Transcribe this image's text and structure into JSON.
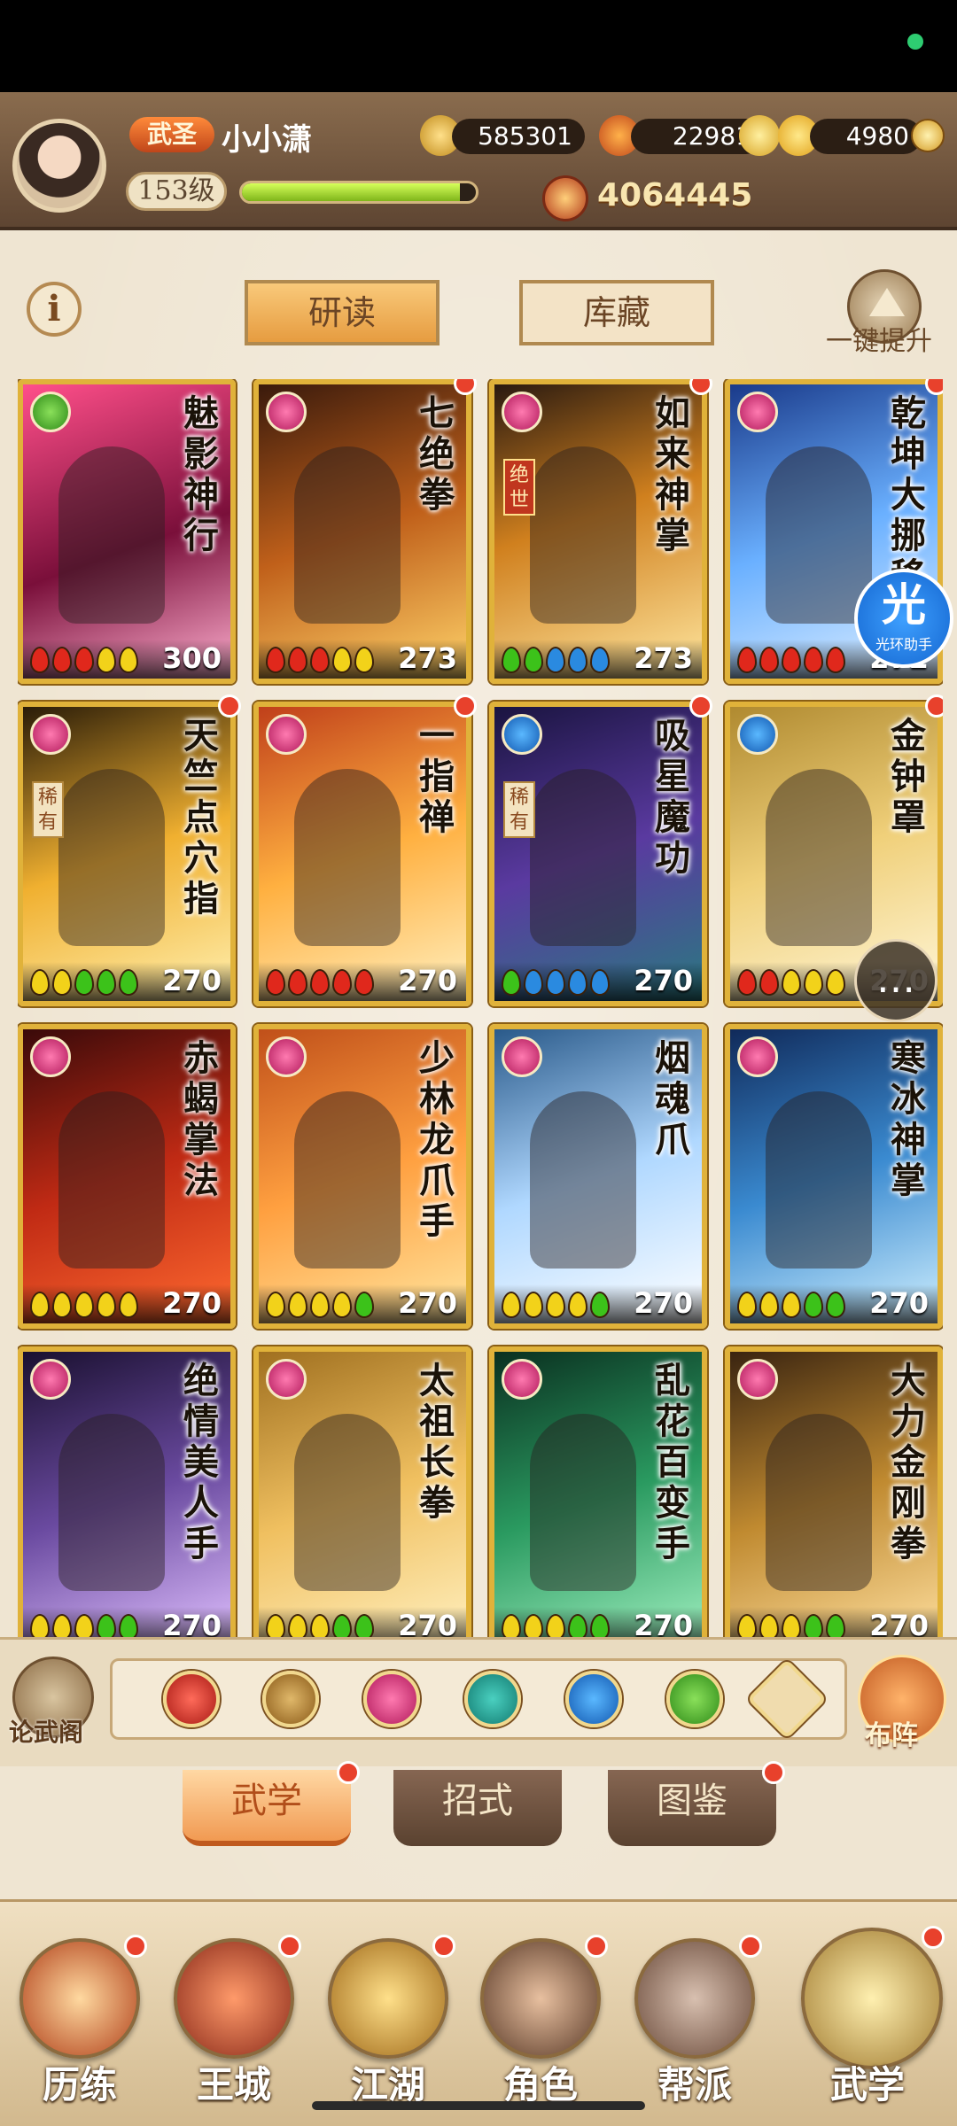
{
  "colors": {
    "accent": "#e69c40",
    "card_border": "#e0b23a",
    "notification": "#e8412c",
    "exp_bar": "#a8d43a"
  },
  "header": {
    "rank": "武圣",
    "player_name": "小小潇",
    "level": "153级",
    "exp_fraction": 0.93,
    "currencies": [
      {
        "name": "copper-coin",
        "value": "585301"
      },
      {
        "name": "flame-crystal",
        "value": "22981"
      },
      {
        "name": "gold-ingot",
        "value": "4980"
      }
    ],
    "combat_power": "4064445"
  },
  "toolbar": {
    "info_label": "i",
    "tabs": [
      {
        "label": "研读",
        "active": true
      },
      {
        "label": "库藏",
        "active": false
      }
    ],
    "upgrade_label": "一键提升"
  },
  "cards": [
    {
      "title": "魅影神行",
      "score": "300",
      "type_icon": "green-swirl",
      "gems": [
        "red",
        "red",
        "red",
        "yellow",
        "yellow"
      ],
      "tag": "",
      "notify": false
    },
    {
      "title": "七绝拳",
      "score": "273",
      "type_icon": "pink-lotus",
      "gems": [
        "red",
        "red",
        "red",
        "yellow",
        "yellow"
      ],
      "tag": "",
      "notify": true
    },
    {
      "title": "如来神掌",
      "score": "273",
      "type_icon": "pink-lotus",
      "gems": [
        "green",
        "green",
        "blue",
        "blue",
        "blue"
      ],
      "tag": "绝世",
      "notify": true
    },
    {
      "title": "乾坤大挪移",
      "score": "272",
      "type_icon": "pink-lotus",
      "gems": [
        "red",
        "red",
        "red",
        "red",
        "red"
      ],
      "tag": "",
      "notify": true
    },
    {
      "title": "天竺点穴指",
      "score": "270",
      "type_icon": "pink-lotus",
      "gems": [
        "yellow",
        "yellow",
        "green",
        "green",
        "green"
      ],
      "tag": "稀有",
      "notify": true
    },
    {
      "title": "一指禅",
      "score": "270",
      "type_icon": "pink-lotus",
      "gems": [
        "red",
        "red",
        "red",
        "red",
        "red"
      ],
      "tag": "",
      "notify": true
    },
    {
      "title": "吸星魔功",
      "score": "270",
      "type_icon": "blue-taiji",
      "gems": [
        "green",
        "blue",
        "blue",
        "blue",
        "blue"
      ],
      "tag": "稀有",
      "notify": true
    },
    {
      "title": "金钟罩",
      "score": "270",
      "type_icon": "blue-taiji",
      "gems": [
        "red",
        "red",
        "yellow",
        "yellow",
        "yellow"
      ],
      "tag": "",
      "notify": true
    },
    {
      "title": "赤蝎掌法",
      "score": "270",
      "type_icon": "pink-lotus",
      "gems": [
        "yellow",
        "yellow",
        "yellow",
        "yellow",
        "yellow"
      ],
      "tag": "",
      "notify": false
    },
    {
      "title": "少林龙爪手",
      "score": "270",
      "type_icon": "pink-lotus",
      "gems": [
        "yellow",
        "yellow",
        "yellow",
        "yellow",
        "green"
      ],
      "tag": "",
      "notify": false
    },
    {
      "title": "烟魂爪",
      "score": "270",
      "type_icon": "pink-lotus",
      "gems": [
        "yellow",
        "yellow",
        "yellow",
        "yellow",
        "green"
      ],
      "tag": "",
      "notify": false
    },
    {
      "title": "寒冰神掌",
      "score": "270",
      "type_icon": "pink-lotus",
      "gems": [
        "yellow",
        "yellow",
        "yellow",
        "green",
        "green"
      ],
      "tag": "",
      "notify": false
    },
    {
      "title": "绝情美人手",
      "score": "270",
      "type_icon": "pink-lotus",
      "gems": [
        "yellow",
        "yellow",
        "yellow",
        "green",
        "green"
      ],
      "tag": "",
      "notify": false
    },
    {
      "title": "太祖长拳",
      "score": "270",
      "type_icon": "pink-lotus",
      "gems": [
        "yellow",
        "yellow",
        "yellow",
        "green",
        "green"
      ],
      "tag": "",
      "notify": false
    },
    {
      "title": "乱花百变手",
      "score": "270",
      "type_icon": "pink-lotus",
      "gems": [
        "yellow",
        "yellow",
        "yellow",
        "green",
        "green"
      ],
      "tag": "",
      "notify": false
    },
    {
      "title": "大力金刚拳",
      "score": "270",
      "type_icon": "pink-lotus",
      "gems": [
        "yellow",
        "yellow",
        "yellow",
        "green",
        "green"
      ],
      "tag": "",
      "notify": false
    }
  ],
  "assistant": {
    "glyph": "光",
    "label": "光环助手"
  },
  "chat": {
    "glyph": "…"
  },
  "filter_bar": {
    "left_label": "论武阁",
    "icons": [
      "red-sword-icon",
      "gold-spear-icon",
      "pink-lotus-icon",
      "teal-fan-icon",
      "blue-taiji-icon",
      "green-swirl-icon",
      "sort-arrow-icon"
    ],
    "right_label": "布阵"
  },
  "sub_tabs": [
    {
      "label": "武学",
      "active": true,
      "notify": true
    },
    {
      "label": "招式",
      "active": false,
      "notify": false
    },
    {
      "label": "图鉴",
      "active": false,
      "notify": true
    }
  ],
  "bottom_nav": [
    {
      "label": "历练",
      "icon": "scroll-sword-icon",
      "notify": true
    },
    {
      "label": "王城",
      "icon": "palace-gate-icon",
      "notify": true
    },
    {
      "label": "江湖",
      "icon": "sword-cloud-icon",
      "notify": true
    },
    {
      "label": "角色",
      "icon": "straw-hat-hero-icon",
      "notify": true
    },
    {
      "label": "帮派",
      "icon": "guild-emblem-icon",
      "notify": true
    },
    {
      "label": "武学",
      "icon": "martial-scrolls-icon",
      "notify": true,
      "active": true
    }
  ]
}
